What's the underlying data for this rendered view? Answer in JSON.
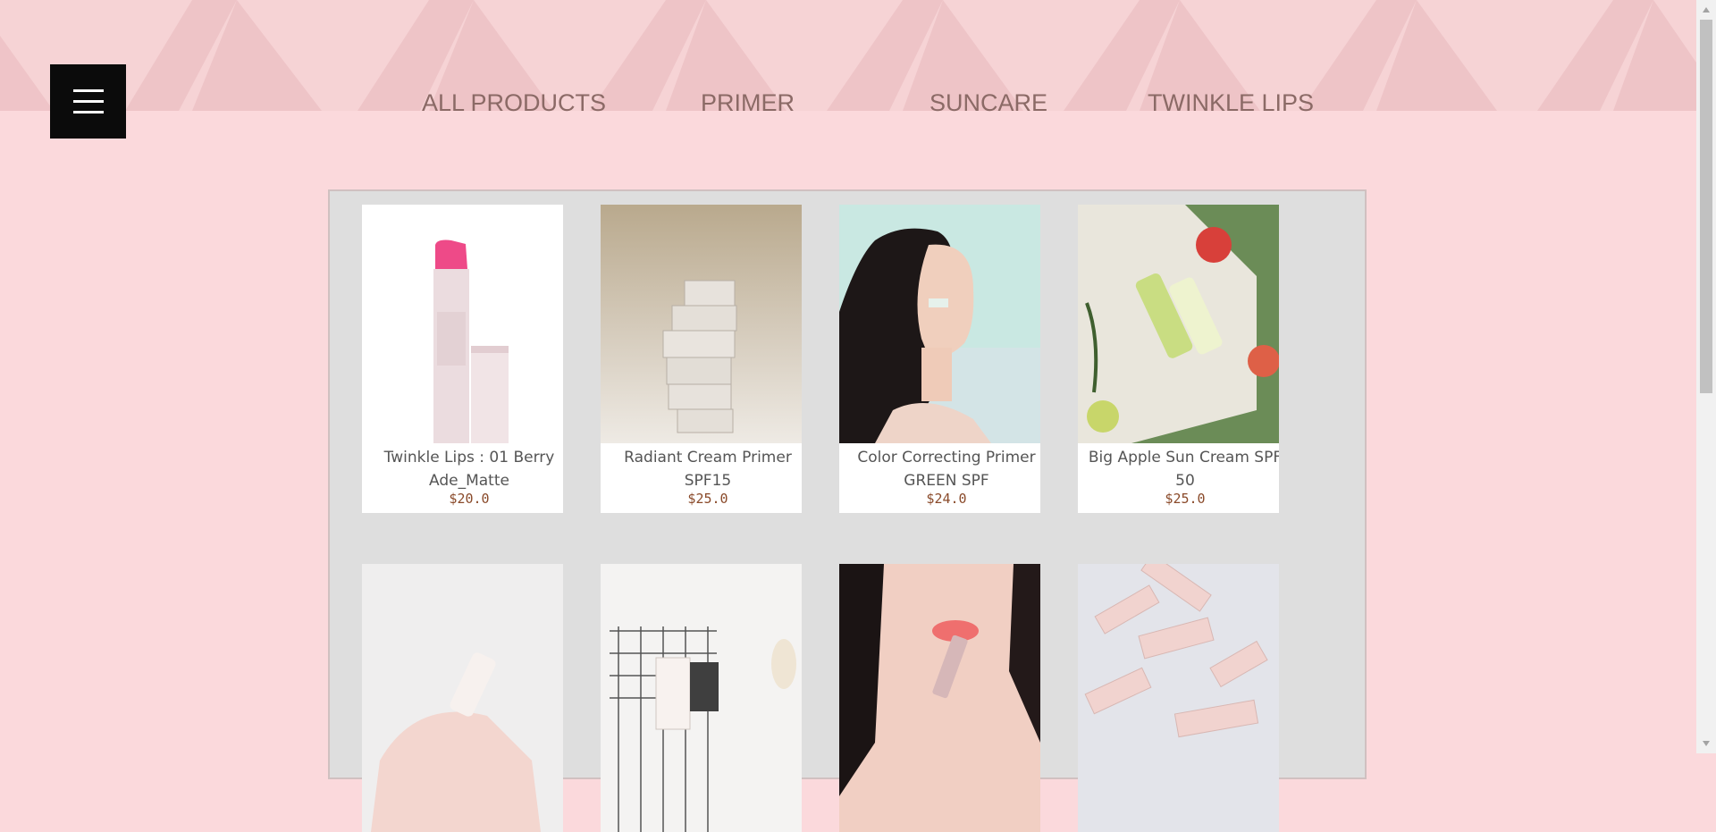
{
  "menu": {
    "icon": "hamburger-icon"
  },
  "nav": [
    {
      "label": "ALL PRODUCTS"
    },
    {
      "label": "PRIMER"
    },
    {
      "label": "SUNCARE"
    },
    {
      "label": "TWINKLE LIPS"
    }
  ],
  "products": [
    {
      "name": "Twinkle Lips : 01 Berry Ade_Matte",
      "price": "$20.0"
    },
    {
      "name": "Radiant Cream Primer SPF15",
      "price": "$25.0"
    },
    {
      "name": "Color Correcting Primer GREEN SPF",
      "price": "$24.0"
    },
    {
      "name": "Big Apple Sun Cream SPF 50",
      "price": "$25.0"
    }
  ],
  "colors": {
    "page_background": "#fbd9dc",
    "banner": "#f6d3d5",
    "nav_text": "#8b6a66",
    "price_text": "#8a4a2a"
  }
}
